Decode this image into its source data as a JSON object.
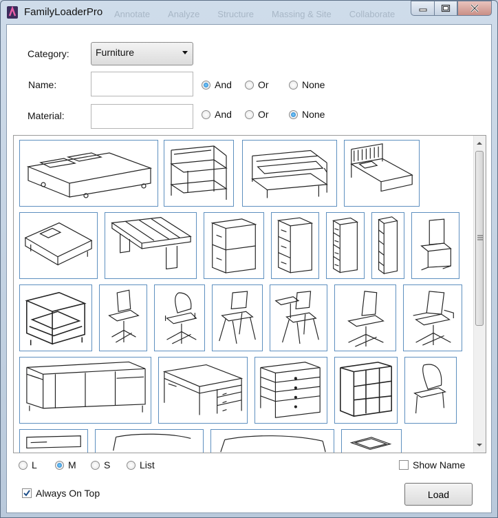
{
  "window": {
    "title": "FamilyLoaderPro",
    "background_ribbon_tabs": [
      "Annotate",
      "Analyze",
      "Structure",
      "Massing & Site",
      "Collaborate"
    ]
  },
  "filters": {
    "category": {
      "label": "Category:",
      "value": "Furniture"
    },
    "name": {
      "label": "Name:",
      "value": "",
      "options": [
        "And",
        "Or",
        "None"
      ],
      "selected": "And"
    },
    "material": {
      "label": "Material:",
      "value": "",
      "options": [
        "And",
        "Or",
        "None"
      ],
      "selected": "None"
    }
  },
  "gallery": {
    "items": [
      {
        "icon": "double-bed-icon"
      },
      {
        "icon": "bunk-bed-icon"
      },
      {
        "icon": "sofa-bed-icon"
      },
      {
        "icon": "single-bed-icon"
      },
      {
        "icon": "platform-bed-icon"
      },
      {
        "icon": "bench-icon"
      },
      {
        "icon": "two-drawer-cabinet-icon"
      },
      {
        "icon": "three-drawer-cabinet-icon"
      },
      {
        "icon": "four-drawer-cabinet-icon"
      },
      {
        "icon": "five-drawer-cabinet-icon"
      },
      {
        "icon": "cantilever-chair-icon"
      },
      {
        "icon": "armchair-icon"
      },
      {
        "icon": "task-chair-icon"
      },
      {
        "icon": "office-chair-icon"
      },
      {
        "icon": "stacking-chair-icon"
      },
      {
        "icon": "tablet-arm-chair-icon"
      },
      {
        "icon": "swivel-chair-icon"
      },
      {
        "icon": "executive-chair-icon"
      },
      {
        "icon": "credenza-icon"
      },
      {
        "icon": "desk-icon"
      },
      {
        "icon": "dresser-icon"
      },
      {
        "icon": "shelving-unit-icon"
      },
      {
        "icon": "side-chair-icon"
      },
      {
        "icon": "furniture-item-icon"
      },
      {
        "icon": "furniture-item-icon"
      },
      {
        "icon": "furniture-item-icon"
      },
      {
        "icon": "furniture-item-icon"
      }
    ]
  },
  "view_size": {
    "options": [
      "L",
      "M",
      "S",
      "List"
    ],
    "selected": "M"
  },
  "show_name": {
    "label": "Show Name",
    "checked": false
  },
  "always_on_top": {
    "label": "Always On Top",
    "checked": true
  },
  "load_button": {
    "label": "Load"
  },
  "colors": {
    "tile_border": "#5d8fbf",
    "radio_selected": "#1a72c4"
  }
}
